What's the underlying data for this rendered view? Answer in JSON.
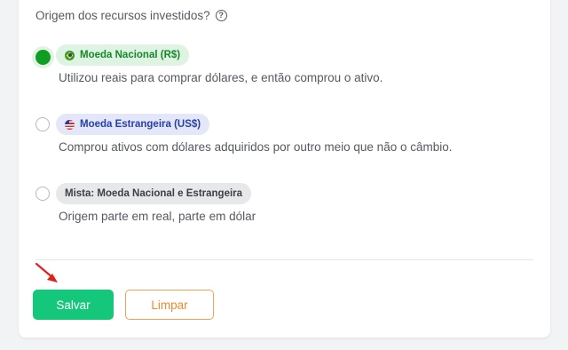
{
  "question": {
    "label": "Origem dos recursos investidos?",
    "help_icon": "help-circle-icon"
  },
  "options": [
    {
      "label": "Moeda Nacional (R$)",
      "description": "Utilizou reais para comprar dólares, e então comprou o ativo.",
      "selected": true,
      "flag_icon": "brazil-flag-icon",
      "badge_color": "#dff3e2"
    },
    {
      "label": "Moeda Estrangeira (US$)",
      "description": "Comprou ativos com dólares adquiridos por outro meio que não o câmbio.",
      "selected": false,
      "flag_icon": "us-flag-icon",
      "badge_color": "#e3e7f7"
    },
    {
      "label": "Mista: Moeda Nacional e Estrangeira",
      "description": "Origem parte em real, parte em dólar",
      "selected": false,
      "badge_color": "#e7e8ea"
    }
  ],
  "actions": {
    "save_label": "Salvar",
    "clear_label": "Limpar"
  },
  "colors": {
    "accent_green": "#14c77b",
    "selected_radio": "#0f9d24",
    "clear_orange": "#f08a2c",
    "annotation_arrow": "#e0201b"
  }
}
